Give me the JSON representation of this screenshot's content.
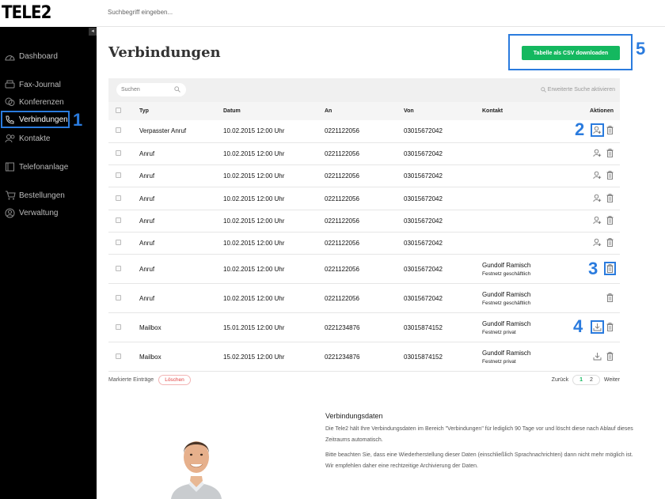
{
  "brand": {
    "logo": "TELE2"
  },
  "topbar": {
    "search_placeholder": "Suchbegriff eingeben..."
  },
  "sidebar": {
    "collapse_glyph": "◂",
    "items": [
      {
        "label": "Dashboard",
        "icon": "dashboard-icon"
      },
      {
        "label": "Fax-Journal",
        "icon": "fax-icon"
      },
      {
        "label": "Konferenzen",
        "icon": "conference-icon"
      },
      {
        "label": "Verbindungen",
        "icon": "phone-icon",
        "active": true
      },
      {
        "label": "Kontakte",
        "icon": "contacts-icon"
      },
      {
        "label": "Telefonanlage",
        "icon": "pbx-icon"
      },
      {
        "label": "Bestellungen",
        "icon": "cart-icon"
      },
      {
        "label": "Verwaltung",
        "icon": "user-icon"
      }
    ]
  },
  "annotations": {
    "n1": "1",
    "n2": "2",
    "n3": "3",
    "n4": "4",
    "n5": "5"
  },
  "accent_color": "#2a7bde",
  "button_color": "#14b85f",
  "main": {
    "title": "Verbindungen",
    "csv_button": "Tabelle als CSV downloaden",
    "search_placeholder": "Suchen",
    "advanced_search": "Erweiterte Suche aktivieren",
    "columns": [
      "Typ",
      "Datum",
      "An",
      "Von",
      "Kontakt",
      "Aktionen"
    ],
    "rows": [
      {
        "typ": "Verpasster Anruf",
        "datum": "10.02.2015 12:00 Uhr",
        "an": "0221122056",
        "von": "03015672042",
        "kontakt_name": "",
        "kontakt_sub": "",
        "actions": [
          "add-contact-icon",
          "trash-icon"
        ]
      },
      {
        "typ": "Anruf",
        "datum": "10.02.2015 12:00 Uhr",
        "an": "0221122056",
        "von": "03015672042",
        "kontakt_name": "",
        "kontakt_sub": "",
        "actions": [
          "add-contact-icon",
          "trash-icon"
        ]
      },
      {
        "typ": "Anruf",
        "datum": "10.02.2015 12:00 Uhr",
        "an": "0221122056",
        "von": "03015672042",
        "kontakt_name": "",
        "kontakt_sub": "",
        "actions": [
          "add-contact-icon",
          "trash-icon"
        ]
      },
      {
        "typ": "Anruf",
        "datum": "10.02.2015 12:00 Uhr",
        "an": "0221122056",
        "von": "03015672042",
        "kontakt_name": "",
        "kontakt_sub": "",
        "actions": [
          "add-contact-icon",
          "trash-icon"
        ]
      },
      {
        "typ": "Anruf",
        "datum": "10.02.2015 12:00 Uhr",
        "an": "0221122056",
        "von": "03015672042",
        "kontakt_name": "",
        "kontakt_sub": "",
        "actions": [
          "add-contact-icon",
          "trash-icon"
        ]
      },
      {
        "typ": "Anruf",
        "datum": "10.02.2015 12:00 Uhr",
        "an": "0221122056",
        "von": "03015672042",
        "kontakt_name": "",
        "kontakt_sub": "",
        "actions": [
          "add-contact-icon",
          "trash-icon"
        ]
      },
      {
        "typ": "Anruf",
        "datum": "10.02.2015 12:00 Uhr",
        "an": "0221122056",
        "von": "03015672042",
        "kontakt_name": "Gundolf Ramisch",
        "kontakt_sub": "Festnetz geschäftlich",
        "actions": [
          "trash-icon"
        ]
      },
      {
        "typ": "Anruf",
        "datum": "10.02.2015 12:00 Uhr",
        "an": "0221122056",
        "von": "03015672042",
        "kontakt_name": "Gundolf Ramisch",
        "kontakt_sub": "Festnetz geschäftlich",
        "actions": [
          "trash-icon"
        ]
      },
      {
        "typ": "Mailbox",
        "datum": "15.01.2015 12:00 Uhr",
        "an": "0221234876",
        "von": "03015874152",
        "kontakt_name": "Gundolf Ramisch",
        "kontakt_sub": "Festnetz privat",
        "actions": [
          "download-icon",
          "trash-icon"
        ]
      },
      {
        "typ": "Mailbox",
        "datum": "15.02.2015 12:00 Uhr",
        "an": "0221234876",
        "von": "03015874152",
        "kontakt_name": "Gundolf Ramisch",
        "kontakt_sub": "Festnetz privat",
        "actions": [
          "download-icon",
          "trash-icon"
        ]
      }
    ],
    "marked_entries": "Markierte Einträge",
    "delete_button": "Löschen",
    "pager": {
      "back": "Zurück",
      "pages": [
        "1",
        "2"
      ],
      "current": "1",
      "next": "Weiter"
    }
  },
  "info": {
    "title": "Verbindungsdaten",
    "p1": "Die Tele2 hält Ihre Verbindungsdaten im Bereich \"Verbindungen\" für lediglich 90 Tage vor und löscht diese nach Ablauf dieses Zeitraums automatisch.",
    "p2": "Bitte beachten Sie, dass eine Wiederherstellung dieser Daten (einschließlich Sprachnachrichten) dann nicht mehr möglich ist. Wir empfehlen daher eine rechtzeitige Archivierung der Daten."
  }
}
